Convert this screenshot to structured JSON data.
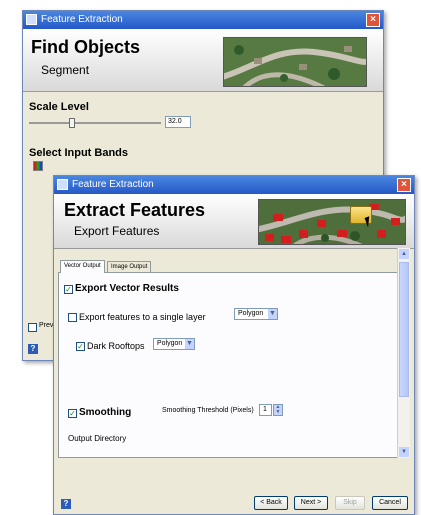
{
  "back_window": {
    "title": "Feature Extraction",
    "header_title": "Find Objects",
    "header_subtitle": "Segment",
    "scale_label": "Scale Level",
    "scale_value": "32.0",
    "bands_label": "Select Input Bands",
    "preview_label": "Prev",
    "slider_position": 0.32
  },
  "front_window": {
    "title": "Feature Extraction",
    "header_title": "Extract Features",
    "header_subtitle": "Export Features",
    "tabs": [
      "Vector Output",
      "Image Output"
    ],
    "export_vector_label": "Export Vector Results",
    "single_layer_label": "Export features to a single layer",
    "single_layer_select": "Polygon",
    "dark_rooftops_label": "Dark Rooftops",
    "dark_rooftops_select": "Polygon",
    "smoothing_label": "Smoothing",
    "smoothing_threshold_label": "Smoothing Threshold (Pixels)",
    "smoothing_threshold_value": "1",
    "output_directory_label": "Output Directory",
    "buttons": {
      "back": "< Back",
      "next": "Next >",
      "skip": "Skip",
      "cancel": "Cancel"
    }
  }
}
